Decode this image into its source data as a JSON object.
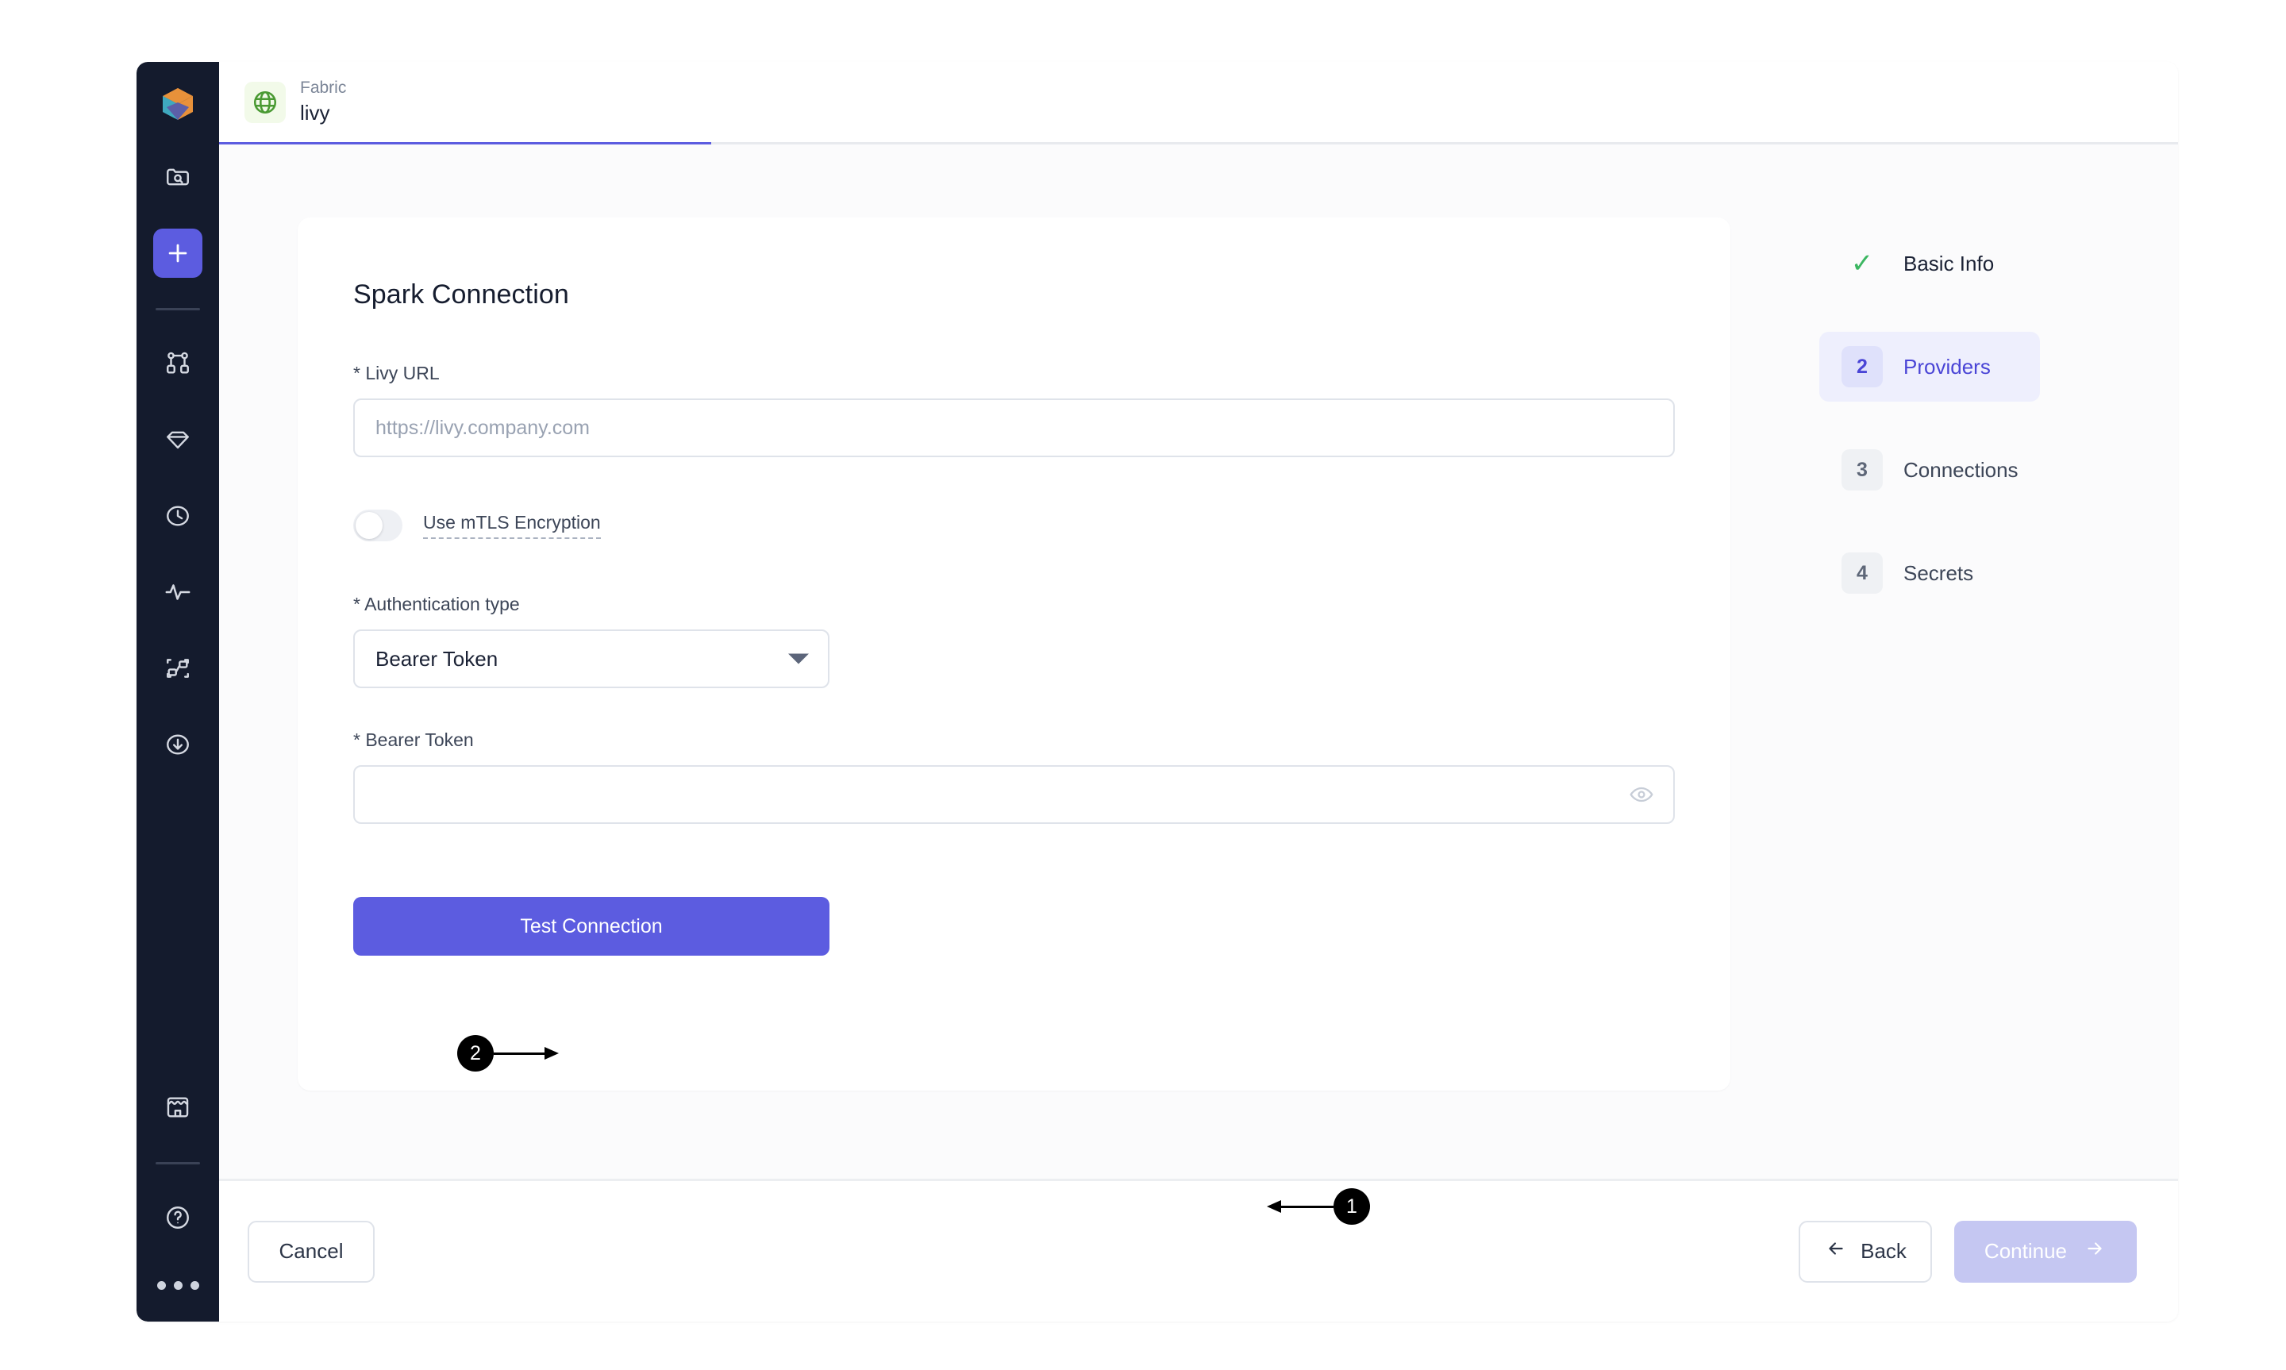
{
  "sidebar": {
    "logo_icon": "cube-logo-icon",
    "items": [
      {
        "icon": "folder-search-icon",
        "name": "browse",
        "active": false
      },
      {
        "icon": "plus-icon",
        "name": "add",
        "active": true
      },
      {
        "icon": "pipeline-nodes-icon",
        "name": "pipelines",
        "active": false
      },
      {
        "icon": "diamond-icon",
        "name": "models",
        "active": false
      },
      {
        "icon": "clock-icon",
        "name": "schedules",
        "active": false
      },
      {
        "icon": "activity-pulse-icon",
        "name": "monitoring",
        "active": false
      },
      {
        "icon": "lineage-graph-icon",
        "name": "lineage",
        "active": false
      },
      {
        "icon": "download-circle-icon",
        "name": "ingest",
        "active": false
      },
      {
        "icon": "storefront-icon",
        "name": "marketplace",
        "active": false
      },
      {
        "icon": "help-circle-icon",
        "name": "help",
        "active": false
      },
      {
        "icon": "ellipsis-icon",
        "name": "more",
        "active": false
      }
    ]
  },
  "tab": {
    "icon": "globe-icon",
    "subtitle": "Fabric",
    "title": "livy",
    "accent_color": "#5c5ce0"
  },
  "form": {
    "title": "Spark Connection",
    "livy_url": {
      "label": "* Livy URL",
      "value": "",
      "placeholder": "https://livy.company.com"
    },
    "mtls": {
      "label": "Use mTLS Encryption",
      "enabled": false
    },
    "auth_type": {
      "label": "* Authentication type",
      "value": "Bearer Token"
    },
    "bearer_token": {
      "label": "* Bearer Token",
      "value": "",
      "placeholder": "",
      "reveal_icon": "eye-icon"
    },
    "test_button": "Test Connection"
  },
  "stepper": {
    "steps": [
      {
        "badge": "✓",
        "label": "Basic Info",
        "state": "done"
      },
      {
        "badge": "2",
        "label": "Providers",
        "state": "current"
      },
      {
        "badge": "3",
        "label": "Connections",
        "state": "pending"
      },
      {
        "badge": "4",
        "label": "Secrets",
        "state": "pending"
      }
    ]
  },
  "footer": {
    "cancel": "Cancel",
    "back": "Back",
    "continue": "Continue"
  },
  "annotations": [
    {
      "id": "1",
      "label": "1",
      "points_to": "test-connection-button"
    },
    {
      "id": "2",
      "label": "2",
      "points_to": "bearer-token-input"
    }
  ],
  "colors": {
    "accent": "#5c5ce0",
    "accent_muted": "#c5c7f2",
    "sidebar_bg": "#141b2d",
    "success_green": "#3bb661",
    "page_bg": "#fbfbfc"
  }
}
